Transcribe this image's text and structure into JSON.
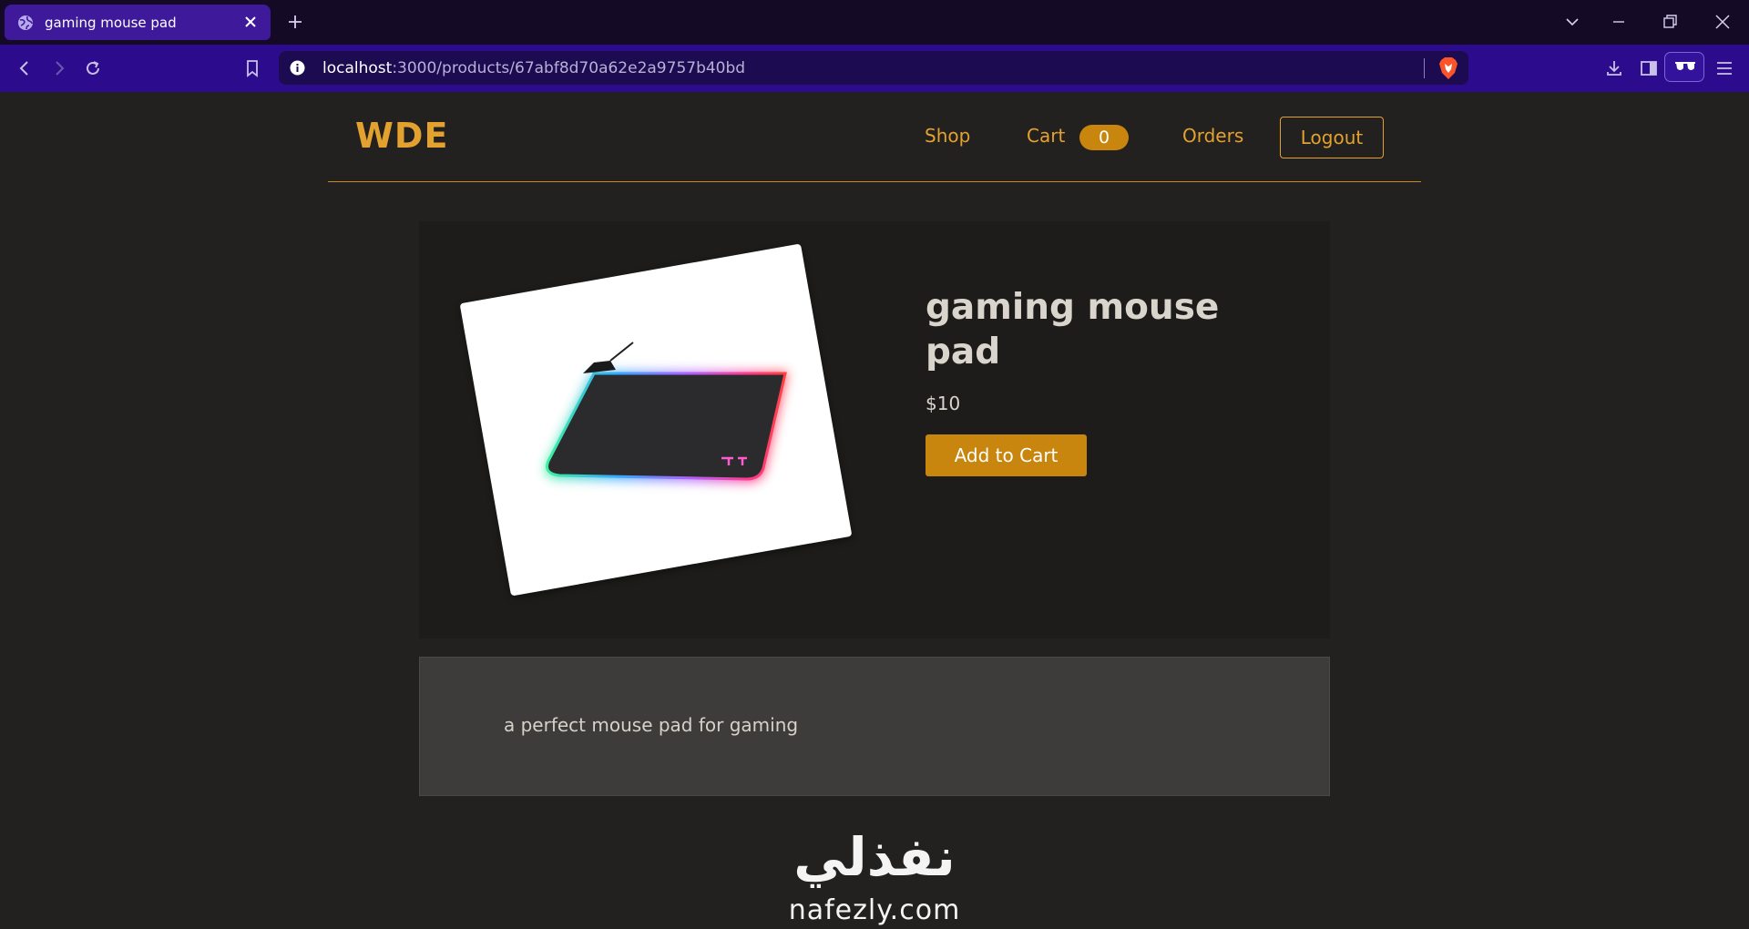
{
  "browser": {
    "tab_title": "gaming mouse pad",
    "url_host": "localhost",
    "url_rest": ":3000/products/67abf8d70a62e2a9757b40bd"
  },
  "icons": {
    "tab_favicon": "globe-icon",
    "tab_close": "close-icon",
    "new_tab": "plus-icon",
    "back": "back-arrow-icon",
    "forward": "forward-arrow-icon",
    "reload": "reload-icon",
    "bookmark": "bookmark-icon",
    "site_info": "info-icon",
    "brave_shield": "brave-shield-icon",
    "downloads": "download-icon",
    "sidebar": "sidebar-icon",
    "private": "glasses-icon",
    "menu": "hamburger-menu-icon"
  },
  "nav": {
    "logo": "WDE",
    "shop": "Shop",
    "cart": "Cart",
    "cart_count": "0",
    "orders": "Orders",
    "logout": "Logout"
  },
  "product": {
    "title": "gaming mouse pad",
    "price": "$10",
    "add_to_cart": "Add to Cart",
    "description": "a perfect mouse pad for gaming"
  },
  "watermark": {
    "arabic": "نفذلي",
    "latin": "nafezly.com"
  },
  "colors": {
    "accent": "#e3a12f",
    "button": "#c8860e",
    "page_bg": "#23211f",
    "card_bg": "#1d1c1a",
    "desc_bg": "#3d3c3a",
    "tab_active": "#3e1a9a",
    "toolbar": "#2c0c8c"
  }
}
